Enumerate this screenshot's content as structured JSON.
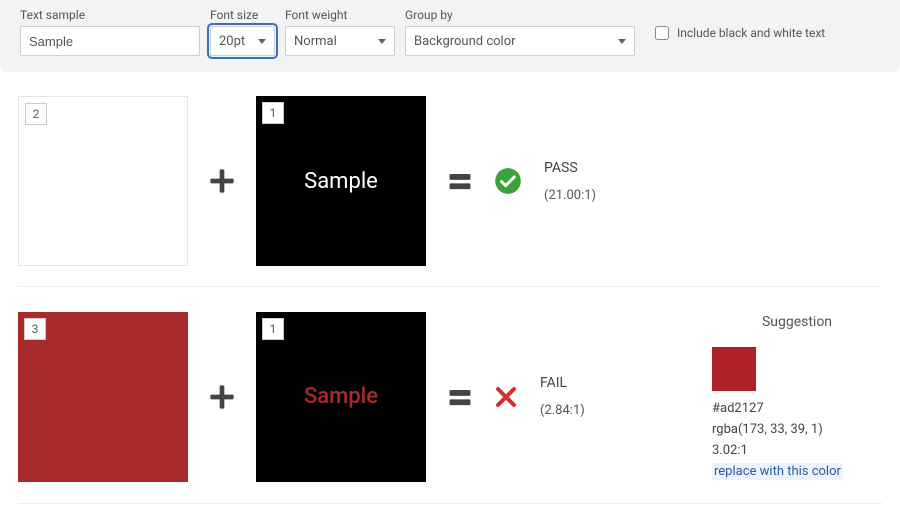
{
  "toolbar": {
    "text_sample_label": "Text sample",
    "text_sample_value": "Sample",
    "font_size_label": "Font size",
    "font_size_value": "20pt",
    "font_weight_label": "Font weight",
    "font_weight_value": "Normal",
    "group_by_label": "Group by",
    "group_by_value": "Background color",
    "bw_label": "Include black and white text"
  },
  "rows": [
    {
      "fg_num": "2",
      "fg_color": "#ffffff",
      "bg_num": "1",
      "bg_color": "#000000",
      "sample": "Sample",
      "sample_text_color": "#ffffff",
      "status": "PASS",
      "ratio": "(21.00:1)",
      "pass": true
    },
    {
      "fg_num": "3",
      "fg_color": "#a72b2b",
      "bg_num": "1",
      "bg_color": "#000000",
      "sample": "Sample",
      "sample_text_color": "#a72b2b",
      "status": "FAIL",
      "ratio": "(2.84:1)",
      "pass": false,
      "suggestion": {
        "title": "Suggestion",
        "swatch_color": "#ad2127",
        "hex": "#ad2127",
        "rgba": "rgba(173, 33, 39, 1)",
        "ratio": "3.02:1",
        "link": "replace with this color"
      }
    }
  ]
}
